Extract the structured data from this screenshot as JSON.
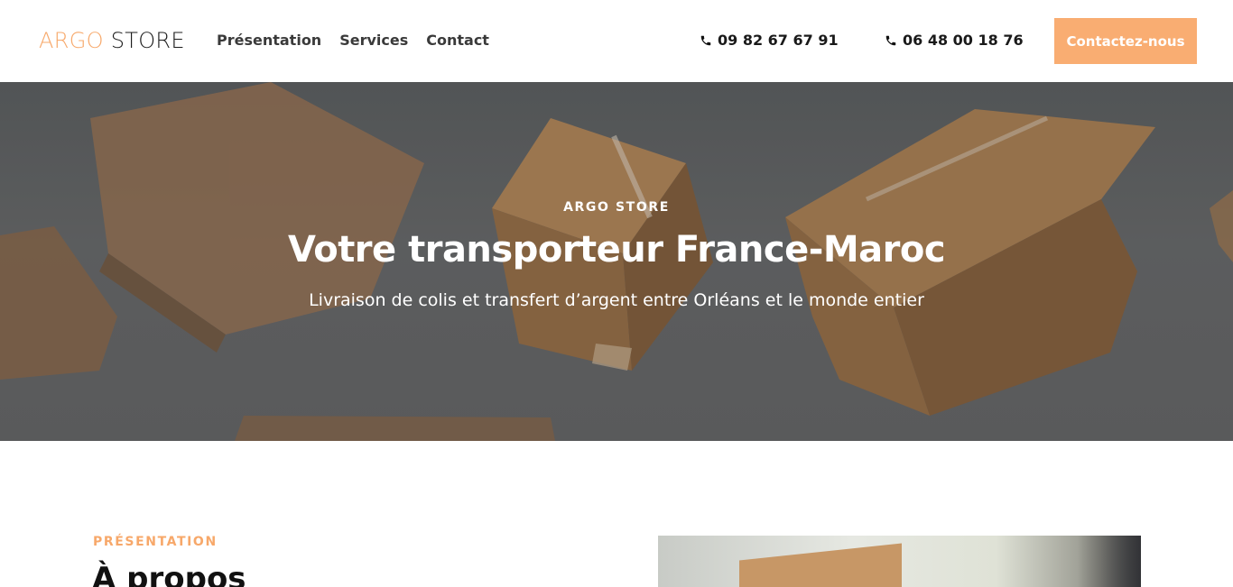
{
  "header": {
    "logo_part1": "ARGO",
    "logo_part2": "STORE",
    "nav": [
      {
        "label": "Présentation"
      },
      {
        "label": "Services"
      },
      {
        "label": "Contact"
      }
    ],
    "phone1": "09 82 67 67 91",
    "phone2": "06 48 00 18 76",
    "cta_label": "Contactez-nous",
    "icons": {
      "phone": "phone-icon"
    }
  },
  "hero": {
    "kicker": "ARGO STORE",
    "title": "Votre transporteur France-Maroc",
    "subtitle": "Livraison de colis et transfert d’argent entre Orléans et le monde entier"
  },
  "presentation": {
    "kicker": "PRÉSENTATION",
    "title": "À propos"
  },
  "colors": {
    "accent": "#f9ad72",
    "text_dark": "#1c1c1c",
    "hero_overlay": "#5e6163"
  }
}
